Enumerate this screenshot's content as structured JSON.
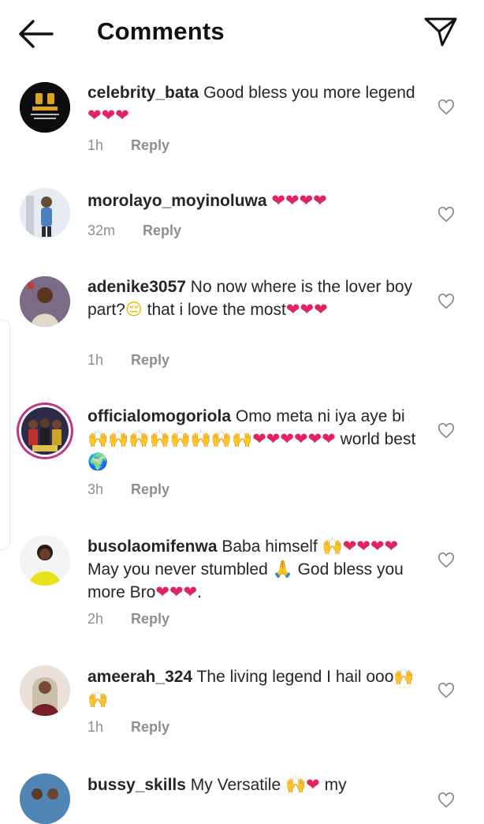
{
  "header": {
    "title": "Comments"
  },
  "reply_label": "Reply",
  "colors": {
    "heart": "#e0245e",
    "muted": "#8e8e8e",
    "text": "#262626"
  },
  "comments": [
    {
      "username": "celebrity_bata",
      "text_a": "Good bless you more legend ",
      "emoji_a": "❤❤❤",
      "time": "1h"
    },
    {
      "username": "morolayo_moyinoluwa",
      "text_a": "",
      "emoji_a": "❤❤❤❤",
      "time": "32m"
    },
    {
      "username": "adenike3057",
      "text_a": "No now where is the lover boy part?",
      "emoji_a": "😔",
      "text_b": " that i love the most",
      "emoji_b": "❤❤❤",
      "time": "1h"
    },
    {
      "username": "officialomogoriola",
      "text_a": "Omo meta ni iya aye bi",
      "emoji_a": "🙌🙌🙌🙌🙌🙌🙌🙌",
      "emoji_b": "❤❤❤❤❤❤",
      "text_b": " world best ",
      "emoji_c": "🌍",
      "time": "3h"
    },
    {
      "username": "busolaomifenwa",
      "text_a": "Baba himself ",
      "emoji_a": "🙌",
      "emoji_b": "❤❤❤❤",
      "text_b": "May you never stumbled ",
      "emoji_c": "🙏",
      "text_c": " God bless you more Bro",
      "emoji_d": "❤❤❤",
      "text_d": ".",
      "time": "2h"
    },
    {
      "username": "ameerah_324",
      "text_a": "The living legend I hail ooo",
      "emoji_a": "🙌🙌",
      "time": "1h"
    },
    {
      "username": "bussy_skills",
      "text_a": "My Versatile ",
      "emoji_a": "🙌",
      "emoji_b": "❤",
      "text_b": " my",
      "time": ""
    }
  ]
}
